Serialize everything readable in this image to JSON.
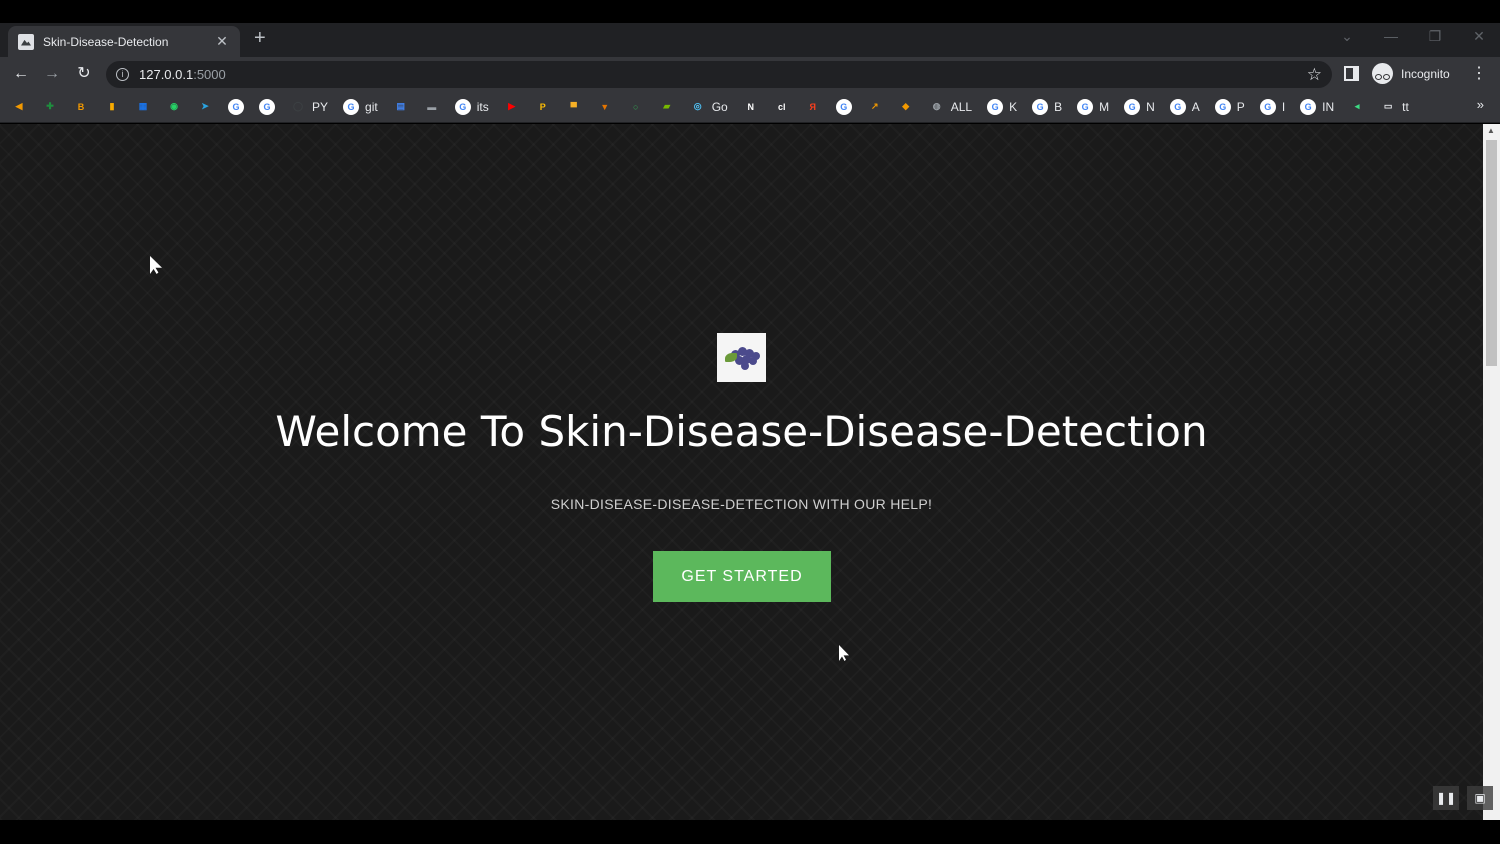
{
  "browser": {
    "tab": {
      "title": "Skin-Disease-Detection",
      "close_glyph": "✕",
      "favicon": "image-icon"
    },
    "new_tab_glyph": "+",
    "window_controls": {
      "dropdown": "⌄",
      "minimize": "—",
      "restore": "❐",
      "close": "✕"
    },
    "nav": {
      "back": "←",
      "forward": "→",
      "reload": "↻"
    },
    "url": {
      "host": "127.0.0.1",
      "port": ":5000"
    },
    "star_glyph": "☆",
    "profile_label": "Incognito",
    "menu_glyph": "⋮",
    "bookmarks_more": "»",
    "bookmarks": [
      {
        "icon": "bookmark-orange-icon",
        "color": "#f29900",
        "glyph": "◀",
        "label": ""
      },
      {
        "icon": "plus-green-icon",
        "color": "#1e8e3e",
        "glyph": "✚",
        "label": ""
      },
      {
        "icon": "app-orange-icon",
        "color": "#f29900",
        "glyph": "B",
        "label": ""
      },
      {
        "icon": "analytics-icon",
        "color": "#f9ab00",
        "glyph": "▮",
        "label": ""
      },
      {
        "icon": "grid-blue-icon",
        "color": "#1a73e8",
        "glyph": "▦",
        "label": ""
      },
      {
        "icon": "whatsapp-icon",
        "color": "#25d366",
        "glyph": "◉",
        "label": ""
      },
      {
        "icon": "telegram-icon",
        "color": "#2aa3df",
        "glyph": "➤",
        "label": ""
      },
      {
        "icon": "google-icon",
        "color": "#ffffff",
        "glyph": "G",
        "label": ""
      },
      {
        "icon": "google-icon",
        "color": "#ffffff",
        "glyph": "G",
        "label": ""
      },
      {
        "icon": "github-icon",
        "color": "#3c4043",
        "glyph": "◯",
        "label": "PY"
      },
      {
        "icon": "google-icon",
        "color": "#ffffff",
        "glyph": "G",
        "label": "git"
      },
      {
        "icon": "doc-blue-icon",
        "color": "#4285f4",
        "glyph": "▤",
        "label": ""
      },
      {
        "icon": "car-icon",
        "color": "#9aa0a6",
        "glyph": "▬",
        "label": ""
      },
      {
        "icon": "google-icon",
        "color": "#ffffff",
        "glyph": "G",
        "label": "its"
      },
      {
        "icon": "youtube-icon",
        "color": "#ff0000",
        "glyph": "▶",
        "label": ""
      },
      {
        "icon": "p-yellow-icon",
        "color": "#fbbc04",
        "glyph": "P",
        "label": ""
      },
      {
        "icon": "folder-icon",
        "color": "#f6b026",
        "glyph": "▀",
        "label": ""
      },
      {
        "icon": "shield-icon",
        "color": "#e37400",
        "glyph": "▼",
        "label": ""
      },
      {
        "icon": "ring-green-icon",
        "color": "#34a853",
        "glyph": "○",
        "label": ""
      },
      {
        "icon": "nvidia-icon",
        "color": "#76b900",
        "glyph": "▰",
        "label": ""
      },
      {
        "icon": "colab-icon",
        "color": "#4fc3f7",
        "glyph": "◎",
        "label": "Go"
      },
      {
        "icon": "notion-icon",
        "color": "#ffffff",
        "glyph": "N",
        "label": ""
      },
      {
        "icon": "ci-icon",
        "color": "#ffffff",
        "glyph": "cl",
        "label": ""
      },
      {
        "icon": "yandex-icon",
        "color": "#fc3f1d",
        "glyph": "Я",
        "label": ""
      },
      {
        "icon": "google-icon",
        "color": "#ffffff",
        "glyph": "G",
        "label": ""
      },
      {
        "icon": "arrow-orange-icon",
        "color": "#f29900",
        "glyph": "↗",
        "label": ""
      },
      {
        "icon": "tag-orange-icon",
        "color": "#f29900",
        "glyph": "◆",
        "label": ""
      },
      {
        "icon": "globe-icon",
        "color": "#9aa0a6",
        "glyph": "◍",
        "label": "ALL"
      },
      {
        "icon": "google-icon",
        "color": "#ffffff",
        "glyph": "G",
        "label": "K"
      },
      {
        "icon": "google-icon",
        "color": "#ffffff",
        "glyph": "G",
        "label": "B"
      },
      {
        "icon": "google-icon",
        "color": "#ffffff",
        "glyph": "G",
        "label": "M"
      },
      {
        "icon": "google-icon",
        "color": "#ffffff",
        "glyph": "G",
        "label": "N"
      },
      {
        "icon": "google-icon",
        "color": "#ffffff",
        "glyph": "G",
        "label": "A"
      },
      {
        "icon": "google-icon",
        "color": "#ffffff",
        "glyph": "G",
        "label": "P"
      },
      {
        "icon": "google-icon",
        "color": "#ffffff",
        "glyph": "G",
        "label": "I"
      },
      {
        "icon": "google-icon",
        "color": "#ffffff",
        "glyph": "G",
        "label": "IN"
      },
      {
        "icon": "android-icon",
        "color": "#3ddc84",
        "glyph": "◂",
        "label": ""
      },
      {
        "icon": "monitor-icon",
        "color": "#e8eaed",
        "glyph": "▭",
        "label": "tt"
      }
    ]
  },
  "page": {
    "title": "Welcome To Skin-Disease-Disease-Detection",
    "subtitle": "SKIN-DISEASE-DISEASE-DETECTION WITH OUR HELP!",
    "cta_label": "GET STARTED",
    "accent_color": "#5cb85c",
    "background_color": "#1a1a1a"
  },
  "media_controls": {
    "pause": "❚❚",
    "pip": "▣"
  }
}
